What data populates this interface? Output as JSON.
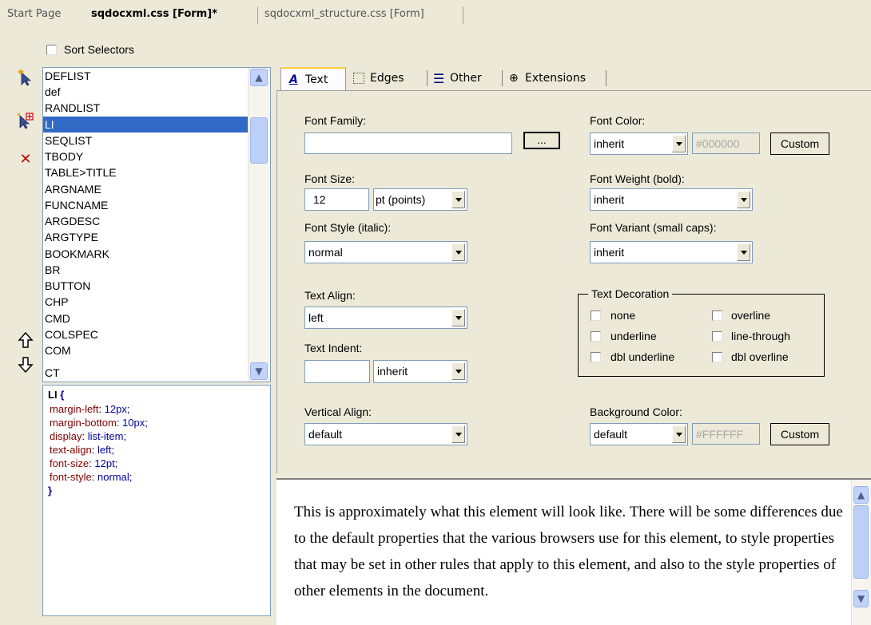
{
  "doc_tabs": {
    "start_page": "Start Page",
    "active_tab": "sqdocxml.css [Form]*",
    "other_tab": "sqdocxml_structure.css [Form]"
  },
  "sort_selectors_label": "Sort Selectors",
  "selectors": [
    "DEFLIST",
    "def",
    "RANDLIST",
    "LI",
    "SEQLIST",
    "TBODY",
    "TABLE>TITLE",
    "ARGNAME",
    "FUNCNAME",
    "ARGDESC",
    "ARGTYPE",
    "BOOKMARK",
    "BR",
    "BUTTON",
    "CHP",
    "CMD",
    "COLSPEC",
    "COM",
    "CT"
  ],
  "selected_selector": "LI",
  "css_preview": {
    "selector": "LI",
    "open_brace": "{",
    "close_brace": "}",
    "declarations": [
      {
        "prop": "margin-left",
        "val": "12px;"
      },
      {
        "prop": "margin-bottom",
        "val": "10px;"
      },
      {
        "prop": "display",
        "val": "list-item;"
      },
      {
        "prop": "text-align",
        "val": "left;"
      },
      {
        "prop": "font-size",
        "val": "12pt;"
      },
      {
        "prop": "font-style",
        "val": "normal;"
      }
    ]
  },
  "prop_tabs": {
    "text": "Text",
    "edges": "Edges",
    "other": "Other",
    "extensions": "Extensions"
  },
  "form": {
    "font_family_label": "Font Family:",
    "font_family_value": "",
    "browse_button": "...",
    "font_size_label": "Font Size:",
    "font_size_value": "12",
    "font_size_unit": "pt (points)",
    "font_style_label": "Font Style (italic):",
    "font_style_value": "normal",
    "text_align_label": "Text Align:",
    "text_align_value": "left",
    "text_indent_label": "Text Indent:",
    "text_indent_value": "",
    "text_indent_unit": "inherit",
    "vertical_align_label": "Vertical Align:",
    "vertical_align_value": "default",
    "font_color_label": "Font Color:",
    "font_color_value": "inherit",
    "font_color_hex": "#000000",
    "custom_button": "Custom",
    "font_weight_label": "Font Weight (bold):",
    "font_weight_value": "inherit",
    "font_variant_label": "Font Variant (small caps):",
    "font_variant_value": "inherit",
    "text_decoration_label": "Text Decoration",
    "decorations": [
      "none",
      "overline",
      "underline",
      "line-through",
      "dbl underline",
      "dbl overline"
    ],
    "background_color_label": "Background Color:",
    "background_color_value": "default",
    "background_color_hex": "#FFFFFF"
  },
  "preview_text": "This is approximately what this element will look like. There will be some differences due to the default properties that the various browsers use for this element, to style properties that may be set in other rules that apply to this element, and also to the style properties of other elements in the document.",
  "colors": {
    "selection": "#316ac5",
    "window": "#ece9d8",
    "active_tab_accent": "#ffc83c"
  }
}
